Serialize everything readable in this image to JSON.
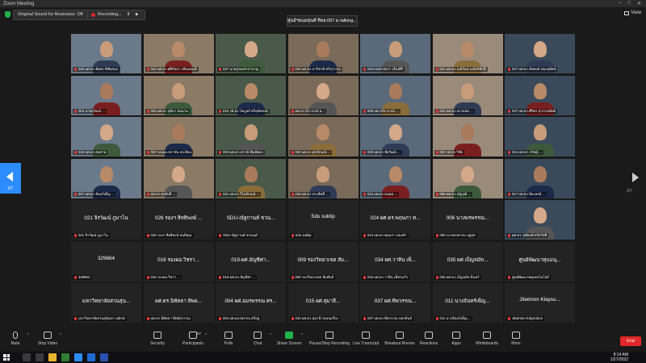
{
  "window": {
    "title": "Zoom Meeting",
    "controls": [
      "–",
      "□",
      "✕"
    ]
  },
  "topbar": {
    "original_sound": "Original Sound for Musicians: Off",
    "recording_label": "Recording...",
    "recording_pause": "II",
    "recording_stop": "■",
    "talking": "ศูนย์ฯพนมทุนศ์ ทิพย:057 is talking...",
    "view_label": "View"
  },
  "pager": {
    "left_page": "2/7",
    "right_page": "2/7"
  },
  "tiles": [
    {
      "name": "023 ผศ.ดร.ชัยพร พิชัยสนก",
      "video": true
    },
    {
      "name": "042 ผศ.ดร.ศศิกัลยา กลิ่นหอมดี",
      "video": true
    },
    {
      "name": "027 นายสุรพงษ์ ท่าหาญ",
      "video": true
    },
    {
      "name": "040 ผศ.ดร.ปาริชาติ ศรีสุวรรณ",
      "video": true
    },
    {
      "name": "010รองศาสตรา เรืองศิริ",
      "video": true
    },
    {
      "name": "021 ผศ.ดร.มณีรัตน์ มณีศรีศักดิ์",
      "video": true
    },
    {
      "name": "027 ผศ.ดร.ปัทพงษ์ ฟองสุทัศน์",
      "video": true
    },
    {
      "name": "004 นายสุวัฒน์ ...",
      "video": true
    },
    {
      "name": "025 ผศ.ดร.จุดิมา สมนาม",
      "video": true
    },
    {
      "name": "015 รศ.ดร.ไพบูลย์ ศรีอุทัยพงษ์",
      "video": true
    },
    {
      "name": "ผศ.ดร.จีราภรณ์ ผ...",
      "video": true
    },
    {
      "name": "008 ผศ.ปรียาภรณ์ ...",
      "video": true
    },
    {
      "name": "022 ผศ.ดร.อรรถพล ...",
      "video": true
    },
    {
      "name": "047 ผศ.ดร.ศิริพร สุวรรณทิพย์",
      "video": true
    },
    {
      "name": "016 ผศ.ดร.สมชาย",
      "video": true
    },
    {
      "name": "020 รองผอ.สถาบัน สงเขียน",
      "video": true
    },
    {
      "name": "003 ผศ.ดร.ปราณี พิมพ์ทอง",
      "video": true
    },
    {
      "name": "040 ผศ.ดร.ศุภลักษณ์ ...",
      "video": true
    },
    {
      "name": "030 ผศ.ดร.ชัยวัฒน์ ...",
      "video": true
    },
    {
      "name": "020 รศ.ดร.วิชัย",
      "video": true
    },
    {
      "name": "014 ผศ.ดร.วรัชญ์ ...",
      "video": true
    },
    {
      "name": "007 ผศ.ดร.จันทร์เพ็ญ ...",
      "video": true
    },
    {
      "name": "ผศ.ดร.สุรศักดิ์ ...",
      "video": true
    },
    {
      "name": "021 ผศ.ดร.วิไลลักษณ์ ...",
      "video": true
    },
    {
      "name": "018 ผศ.ดร.ประสิทธิ์ ...",
      "video": true
    },
    {
      "name": "012 ผศ.ดร.ธนพล ...",
      "video": true
    },
    {
      "name": "005 ผศ.ดร.ณัฐวุฒิ ...",
      "video": true
    },
    {
      "name": "017 ผศ.ดร.ปิยะพงษ์ ...",
      "video": true
    },
    {
      "name": "021 จิรวัฒน์ ภูมาโน",
      "big": "021 จิรวัฒน์ ภูมาโน",
      "video": false
    },
    {
      "name": "026 รองฯ สิทธิพงษ์ สนธิคุณ",
      "big": "026 รองฯ สิทธิพงษ์ ...",
      "video": false
    },
    {
      "name": "SDU-ณัฐกานต์ ชวนนท์",
      "big": "SDU-ณัฐกานต์ ชวน...",
      "video": false
    },
    {
      "name": "Sdu suktip",
      "big": "Sdu suktip",
      "video": false
    },
    {
      "name": "024 ผศ.ดร.พฤษภา ทองคำ",
      "big": "024 ผศ.ดร.พฤษภา ท...",
      "video": false
    },
    {
      "name": "006 นางพรพรรณ อยู่สุข",
      "big": "006 นางพรพรรณ...",
      "video": false
    },
    {
      "name": "ผศ.ดร.วุฒิพงศ์ ศรีสวัสดิ์",
      "video": true
    },
    {
      "name": "329664",
      "big": "329664",
      "video": false
    },
    {
      "name": "016 รองผอ.วิชรา ...",
      "big": "016 รองผอ.วิชรา...",
      "video": false
    },
    {
      "name": "019-ผศ.ดร.อัญชิสา ...",
      "big": "019-ผศ.อัญชิศา...",
      "video": false
    },
    {
      "name": "009 รองวิทยาเขต สัมพันธ์",
      "big": "009 รองวิทยาเขต สัม...",
      "video": false
    },
    {
      "name": "034 ผศ.ดร.วาทิน เพ็ชรแก้ว",
      "big": "034 ผศ.วาทิน เพ็...",
      "video": false
    },
    {
      "name": "035 ผศ.ดร.เบ็ญจมัท อินทร์",
      "big": "035 ผศ.เบ็ญจมัท...",
      "video": false
    },
    {
      "name": "ศูนย์พัฒนาพหุเทคโนโลยี",
      "big": "ศูนย์พัฒนาทุนมนุ...",
      "video": false
    },
    {
      "name": "มหาวิทยาลัยสวนสุนันทา admin",
      "big": "มหาวิทยาลัยสวนสุน...",
      "video": false
    },
    {
      "name": "ผศ.ดร.นิพัทธา ทิพย์สุวรรณ",
      "big": "ผศ.ดร.นิพัทธา ทิพย...",
      "video": false
    },
    {
      "name": "004 ผศ.อมรพรรณ ศรีอยู่",
      "big": "004 ผศ.อมรพรรณ ศร...",
      "video": false
    },
    {
      "name": "015 ผศ.ดร.สุมาลี กฤษณเรือง",
      "big": "015 ผศ.สุมาลี...",
      "video": false
    },
    {
      "name": "037 ผศ.ดร.ทิพวรรณ ทองขันธ์",
      "big": "037 ผศ.ทิพวรรณ...",
      "video": false
    },
    {
      "name": "011 นางจันทร์เพ็ญ ...",
      "big": "011 นางจันทร์เพ็ญ...",
      "video": false
    },
    {
      "name": "Jitwimon Klaysubun",
      "big": "Jitwimon Klaysu...",
      "video": false
    }
  ],
  "toolbar": {
    "mute": "Mute",
    "stop_video": "Stop Video",
    "security": "Security",
    "participants": "Participants",
    "participants_count": "57",
    "polls": "Polls",
    "chat": "Chat",
    "share_screen": "Share Screen",
    "pause_stop_recording": "Pause/Stop Recording",
    "live_transcript": "Live Transcript",
    "breakout_rooms": "Breakout Rooms",
    "reactions": "Reactions",
    "apps": "Apps",
    "whiteboards": "Whiteboards",
    "more": "More",
    "end": "End"
  },
  "taskbar": {
    "time": "8:14 AM",
    "date": "1/27/2022"
  },
  "colors": {
    "accent": "#2d8cff",
    "end": "#e02828",
    "share": "#21b34b"
  }
}
